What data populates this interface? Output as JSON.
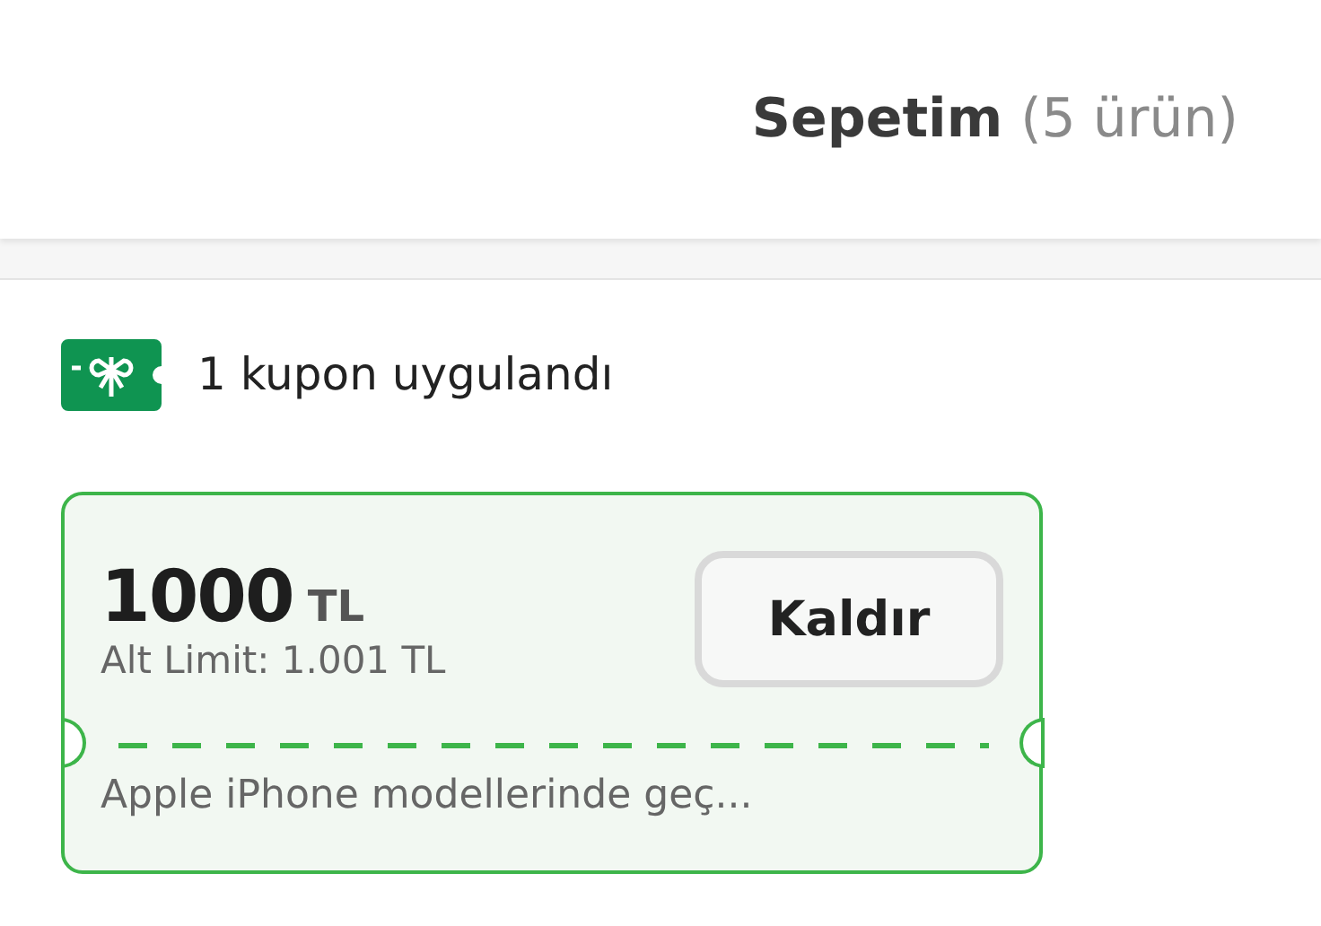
{
  "header": {
    "title": "Sepetim",
    "count": "(5 ürün)"
  },
  "coupons_applied": "1 kupon uygulandı",
  "coupon": {
    "amount": "1000",
    "currency": "TL",
    "limit": "Alt Limit: 1.001 TL",
    "button": "Kaldır",
    "description": "Apple iPhone modellerinde geç..."
  }
}
